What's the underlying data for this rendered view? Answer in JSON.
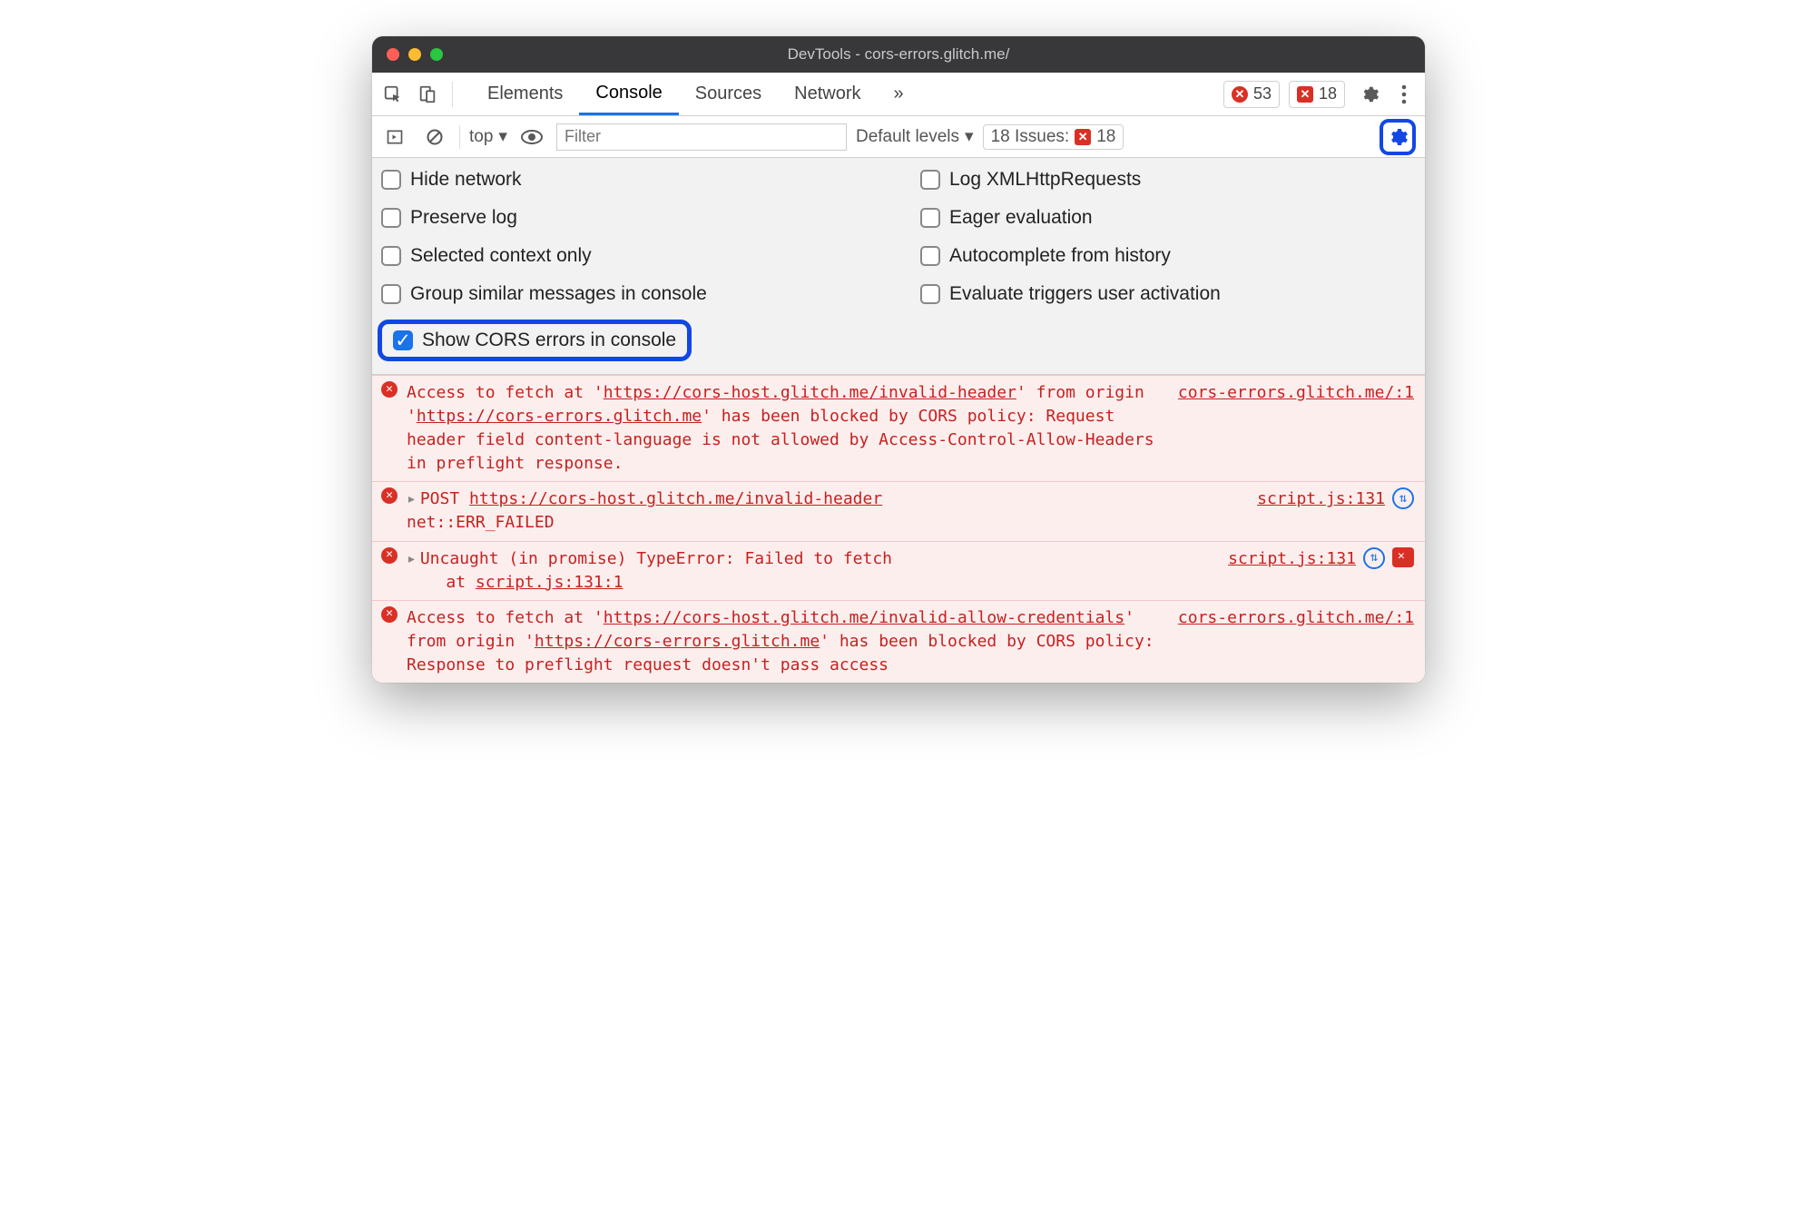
{
  "window": {
    "title": "DevTools - cors-errors.glitch.me/"
  },
  "tabs": {
    "items": [
      "Elements",
      "Console",
      "Sources",
      "Network"
    ],
    "active": "Console"
  },
  "badges": {
    "errors": "53",
    "issues": "18"
  },
  "subbar": {
    "context": "top",
    "filter_placeholder": "Filter",
    "levels": "Default levels",
    "issues_label": "18 Issues:",
    "issues_count": "18"
  },
  "settings": {
    "left": [
      {
        "label": "Hide network",
        "checked": false
      },
      {
        "label": "Preserve log",
        "checked": false
      },
      {
        "label": "Selected context only",
        "checked": false
      },
      {
        "label": "Group similar messages in console",
        "checked": false
      },
      {
        "label": "Show CORS errors in console",
        "checked": true,
        "highlight": true
      }
    ],
    "right": [
      {
        "label": "Log XMLHttpRequests",
        "checked": false
      },
      {
        "label": "Eager evaluation",
        "checked": false
      },
      {
        "label": "Autocomplete from history",
        "checked": false
      },
      {
        "label": "Evaluate triggers user activation",
        "checked": false
      }
    ]
  },
  "messages": [
    {
      "text_pre": "Access to fetch at '",
      "url1": "https://cors-host.glitch.me/invalid-header",
      "text_mid1": "' from origin '",
      "url2": "https://cors-errors.glitch.me",
      "text_post": "' has been blocked by CORS policy: Request header field content-language is not allowed by Access-Control-Allow-Headers in preflight response.",
      "source": "cors-errors.glitch.me/:1"
    },
    {
      "collapsed": true,
      "prefix": "POST ",
      "url1": "https://cors-host.glitch.me/invalid-header",
      "line2": "net::ERR_FAILED",
      "source": "script.js:131",
      "net": true
    },
    {
      "collapsed": true,
      "line1": "Uncaught (in promise) TypeError: Failed to fetch",
      "line2_pre": "    at ",
      "line2_link": "script.js:131:1",
      "source": "script.js:131",
      "net": true,
      "issue": true
    },
    {
      "text_pre": "Access to fetch at '",
      "url1": "https://cors-host.glitch.me/invalid-allow-credentials",
      "text_mid1": "' from origin '",
      "url2": "https://cors-errors.glitch.me",
      "text_post": "' has been blocked by CORS policy: Response to preflight request doesn't pass access",
      "source": "cors-errors.glitch.me/:1"
    }
  ]
}
